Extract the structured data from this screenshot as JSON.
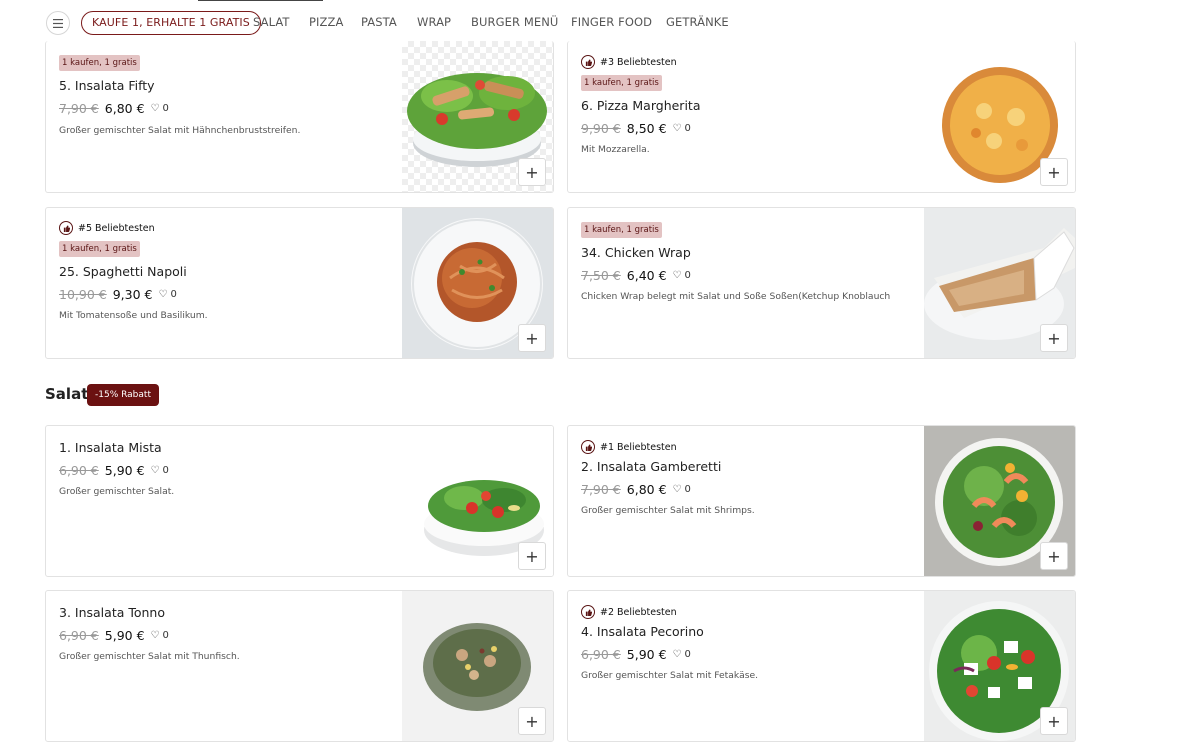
{
  "nav": {
    "tabs": [
      "KAUFE 1, ERHALTE 1 GRATIS",
      "SALAT",
      "PIZZA",
      "PASTA",
      "WRAP",
      "BURGER MENÜ",
      "FINGER FOOD",
      "GETRÄNKE"
    ]
  },
  "cards": [
    {
      "badge": "1 kaufen, 1 gratis",
      "title": "5. Insalata Fifty",
      "old": "7,90 €",
      "new": "6,80 €",
      "likes": "0",
      "desc": "Großer gemischter Salat mit Hähnchenbruststreifen.",
      "image": "chicken-salad-bowl"
    },
    {
      "popular": "#3 Beliebtesten",
      "badge": "1 kaufen, 1 gratis",
      "title": "6. Pizza Margherita",
      "old": "9,90 €",
      "new": "8,50 €",
      "likes": "0",
      "desc": "Mit Mozzarella.",
      "image": "pizza-margherita"
    },
    {
      "popular": "#5 Beliebtesten",
      "badge": "1 kaufen, 1 gratis",
      "title": "25. Spaghetti Napoli",
      "old": "10,90 €",
      "new": "9,30 €",
      "likes": "0",
      "desc": "Mit Tomatensoße und Basilikum.",
      "image": "spaghetti-plate"
    },
    {
      "badge": "1 kaufen, 1 gratis",
      "title": "34. Chicken Wrap",
      "old": "7,50 €",
      "new": "6,40 €",
      "likes": "0",
      "desc": "Chicken Wrap belegt mit Salat und Soße Soßen(Ketchup Knoblauch",
      "image": "chicken-wrap"
    },
    {
      "title": "1. Insalata Mista",
      "old": "6,90 €",
      "new": "5,90 €",
      "likes": "0",
      "desc": "Großer gemischter Salat.",
      "image": "mixed-salad-bowl"
    },
    {
      "popular": "#1 Beliebtesten",
      "title": "2. Insalata Gamberetti",
      "old": "7,90 €",
      "new": "6,80 €",
      "likes": "0",
      "desc": "Großer gemischter Salat mit Shrimps.",
      "image": "shrimp-salad"
    },
    {
      "title": "3. Insalata Tonno",
      "old": "6,90 €",
      "new": "5,90 €",
      "likes": "0",
      "desc": "Großer gemischter Salat mit Thunfisch.",
      "image": "tuna-salad"
    },
    {
      "popular": "#2 Beliebtesten",
      "title": "4. Insalata Pecorino",
      "old": "6,90 €",
      "new": "5,90 €",
      "likes": "0",
      "desc": "Großer gemischter Salat mit Fetakäse.",
      "image": "greek-salad"
    }
  ],
  "section": {
    "title": "Salat",
    "discount": "-15% Rabatt"
  },
  "add_label": "+",
  "colors": {
    "accent": "#6b1111",
    "badge_bg": "#e3c3c3",
    "badge_text": "#5a1515"
  }
}
